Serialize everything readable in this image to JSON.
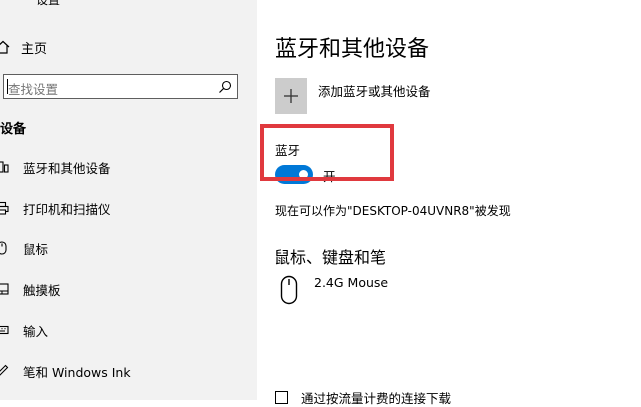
{
  "window": {
    "title": "设置"
  },
  "sidebar": {
    "home_label": "主页",
    "search_placeholder": "查找设置",
    "section_label": "设备",
    "items": [
      {
        "label": "蓝牙和其他设备",
        "icon": "bluetooth-devices-icon"
      },
      {
        "label": "打印机和扫描仪",
        "icon": "printer-icon"
      },
      {
        "label": "鼠标",
        "icon": "mouse-icon"
      },
      {
        "label": "触摸板",
        "icon": "touchpad-icon"
      },
      {
        "label": "输入",
        "icon": "keyboard-icon"
      },
      {
        "label": "笔和 Windows Ink",
        "icon": "pen-icon"
      }
    ]
  },
  "main": {
    "title": "蓝牙和其他设备",
    "add_device_label": "添加蓝牙或其他设备",
    "bluetooth": {
      "label": "蓝牙",
      "toggle_state": "开",
      "enabled": true,
      "discoverable_text": "现在可以作为\"DESKTOP-04UVNR8\"被发现"
    },
    "mouse_keyboard_section": {
      "title": "鼠标、键盘和笔",
      "devices": [
        {
          "name": "2.4G Mouse",
          "icon": "mouse-icon"
        }
      ]
    },
    "metered": {
      "label": "通过按流量计费的连接下载",
      "checked": false
    }
  },
  "colors": {
    "sidebar_bg": "#f2f2f2",
    "accent": "#0078d7",
    "highlight_box": "#e0393e",
    "add_button_bg": "#cccccc"
  }
}
